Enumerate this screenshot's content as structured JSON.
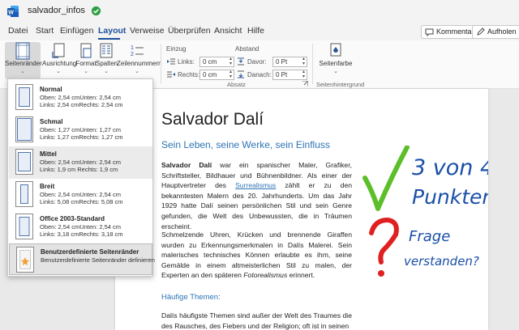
{
  "titlebar": {
    "doc_title": "salvador_infos"
  },
  "menu": {
    "tabs": [
      "Datei",
      "Start",
      "Einfügen",
      "Layout",
      "Verweise",
      "Überprüfen",
      "Ansicht",
      "Hilfe"
    ],
    "active_tab": "Layout",
    "comments_label": "Kommentare",
    "record_label": "Aufholen"
  },
  "ribbon": {
    "margins_label": "Seitenränder",
    "orientation_label": "Ausrichtung",
    "format_label": "Format",
    "columns_label": "Spalten",
    "line_numbers_label": "Zeilennummern",
    "indent_label": "Einzug",
    "spacing_label": "Abstand",
    "left_label": "Links:",
    "right_label": "Rechts:",
    "before_label": "Davor:",
    "after_label": "Danach:",
    "left_value": "0 cm",
    "right_value": "0 cm",
    "before_value": "0 Pt",
    "after_value": "0 Pt",
    "paragraph_group": "Absatz",
    "page_color_label": "Seitenfarbe",
    "page_background_group": "Seitenhintergrund"
  },
  "margins_menu": {
    "options": [
      {
        "name": "Normal",
        "line1": "Oben:  2,54 cmUnten:  2,54 cm",
        "line2": "Links:  2,54 cmRechts:  2,54 cm"
      },
      {
        "name": "Schmal",
        "line1": "Oben:  1,27 cmUnten:  1,27 cm",
        "line2": "Links:  1,27 cmRechts:  1,27 cm"
      },
      {
        "name": "Mittel",
        "line1": "Oben:  2,54 cmUnten:  2,54 cm",
        "line2": "Links:  1,9 cm  Rechts:  1,9 cm"
      },
      {
        "name": "Breit",
        "line1": "Oben:  2,54 cmUnten:  2,54 cm",
        "line2": "Links:  5,08 cmRechts:  5,08 cm"
      },
      {
        "name": "Office 2003-Standard",
        "line1": "Oben:  2,54 cmUnten:  2,54 cm",
        "line2": "Links:  3,18 cmRechts:  3,18 cm"
      }
    ],
    "custom": {
      "name": "Benutzerdefinierte Seitenränder",
      "desc": "Benutzerdefinierte Seitenränder definieren"
    }
  },
  "document": {
    "title": "Salvador Dalí",
    "subtitle": "Sein Leben, seine Werke, sein Einfluss",
    "p1_bold": "Salvador Dalí",
    "p1_a": " war ein spanischer Maler, Grafiker, Schriftsteller, Bildhauer und Bühnenbildner. Als einer der Hauptvertreter des ",
    "p1_link": "Surrealismus",
    "p1_b": " zählt er zu den bekanntesten Malern des 20. Jahrhunderts. Um das Jahr 1929 hatte Dalí seinen persönlichen Stil und sein Genre gefunden, die Welt des Unbewussten, die in Träumen erscheint.",
    "p2_a": "Schmelzende Uhren, Krücken und brennende Giraffen wurden zu Erkennungsmerkmalen in Dalís Malerei. Sein malerisches technisches Können erlaubte es ihm, seine Gemälde in einem altmeisterlichen Stil zu malen, der Experten an den späteren ",
    "p2_italic": "Fotorealismus",
    "p2_b": " erinnert.",
    "themes_heading": "Häufige Themen:",
    "p3": "Dalís häufigste Themen sind außer der Welt des Traumes die des Rausches, des Fiebers und der Religion; oft ist in seinen"
  },
  "annotation": {
    "score_line1": "3 von 4",
    "score_line2": "Punkten",
    "question_line1": "Frage",
    "question_line2": "verstanden?"
  },
  "colors": {
    "accent": "#1c4f9c",
    "heading_blue": "#2e74b5",
    "check_green": "#5cbf2a",
    "question_red": "#e02020",
    "ink_blue": "#1a4fa8"
  }
}
